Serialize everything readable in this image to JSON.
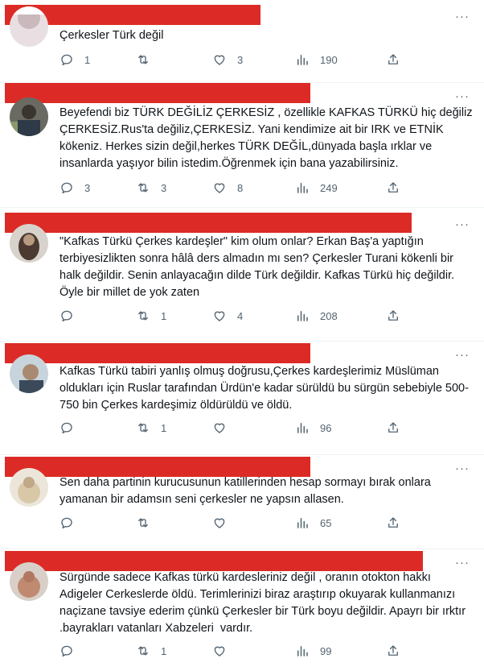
{
  "colors": {
    "redaction": "#dc2b26",
    "muted": "#536471",
    "text": "#0f1419",
    "divider": "#eff3f4"
  },
  "icons": {
    "reply": "reply-icon",
    "retweet": "retweet-icon",
    "like": "heart-icon",
    "views": "views-icon",
    "share": "share-icon",
    "more": "more-icon"
  },
  "more_label": "···",
  "tweets": [
    {
      "text": "Çerkesler Türk değil",
      "replies": "1",
      "retweets": "",
      "likes": "3",
      "views": "190"
    },
    {
      "text": "Beyefendi biz TÜRK DEĞİLİZ ÇERKESİZ , özellikle KAFKAS TÜRKÜ hiç değiliz ÇERKESİZ.Rus'ta değiliz,ÇERKESİZ. Yani kendimize ait bir IRK ve ETNİK kökeniz. Herkes sizin değil,herkes TÜRK DEĞİL,dünyada başla ırklar ve insanlarda yaşıyor bilin istedim.Öğrenmek için bana yazabilirsiniz.",
      "replies": "3",
      "retweets": "3",
      "likes": "8",
      "views": "249"
    },
    {
      "text": "\"Kafkas Türkü Çerkes kardeşler\" kim olum onlar? Erkan Baş'a yaptığın terbiyesizlikten sonra hâlâ ders almadın mı sen? Çerkesler Turani kökenli bir halk değildir. Senin anlayacağın dilde Türk değildir. Kafkas Türkü hiç değildir. Öyle bir millet de yok zaten",
      "replies": "",
      "retweets": "1",
      "likes": "4",
      "views": "208"
    },
    {
      "text": "Kafkas Türkü tabiri yanlış olmuş doğrusu,Çerkes kardeşlerimiz Müslüman oldukları için Ruslar tarafından Ürdün'e kadar sürüldü bu sürgün sebebiyle 500-750 bin Çerkes kardeşimiz öldürüldü ve öldü.",
      "replies": "",
      "retweets": "1",
      "likes": "",
      "views": "96"
    },
    {
      "text": "Sen daha partinin kurucusunun katillerinden hesap sormayı bırak onlara yamanan bir adamsın seni çerkesler ne yapsın allasen.",
      "replies": "",
      "retweets": "",
      "likes": "",
      "views": "65"
    },
    {
      "text": "Sürgünde sadece Kafkas türkü kardesleriniz değil , oranın otokton hakkı Adigeler Cerkeslerde öldü. Terimlerinizi biraz araştırıp okuyarak kullanmanızı naçizane tavsiye ederim çünkü Çerkesler bir Türk boyu değildir. Apayrı bir ırktır .bayrakları vatanları Xabzeleri  vardır.",
      "replies": "",
      "retweets": "1",
      "likes": "",
      "views": "99"
    }
  ]
}
